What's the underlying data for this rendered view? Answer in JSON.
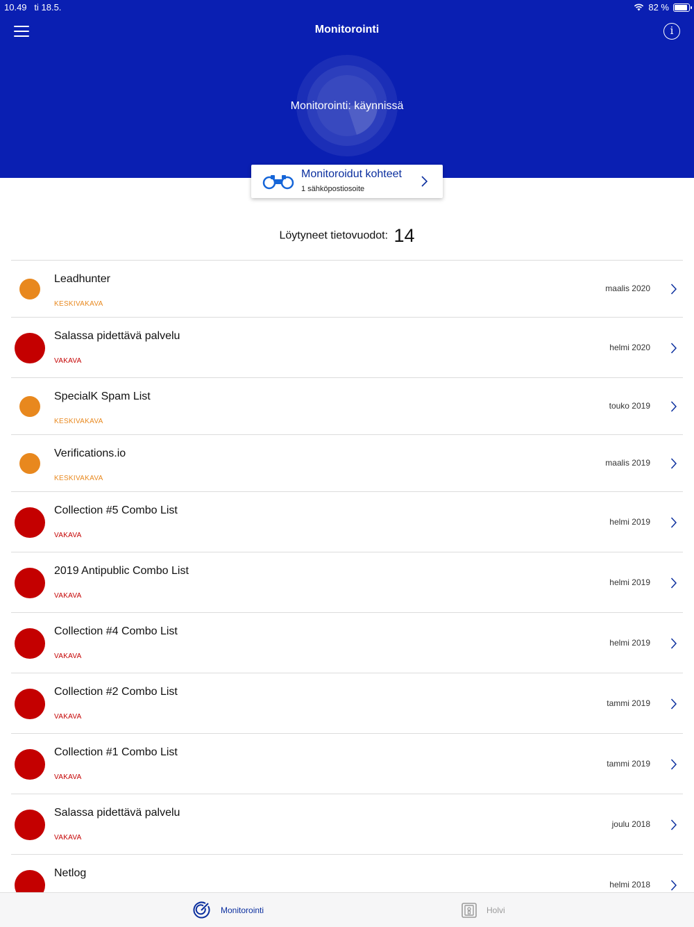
{
  "status_bar": {
    "time": "10.49",
    "date": "ti 18.5.",
    "battery": "82 %"
  },
  "nav": {
    "title": "Monitorointi"
  },
  "monitor": {
    "status_text": "Monitorointi: käynnissä"
  },
  "monitored_card": {
    "title": "Monitoroidut kohteet",
    "subtitle": "1 sähköpostiosoite"
  },
  "breaches": {
    "label": "Löytyneet tietovuodot:",
    "count": "14",
    "items": [
      {
        "name": "Leadhunter",
        "severity": "KESKIVAKAVA",
        "level": "medium",
        "date": "maalis 2020"
      },
      {
        "name": "Salassa pidettävä palvelu",
        "severity": "VAKAVA",
        "level": "high",
        "date": "helmi 2020"
      },
      {
        "name": "SpecialK Spam List",
        "severity": "KESKIVAKAVA",
        "level": "medium",
        "date": "touko 2019"
      },
      {
        "name": "Verifications.io",
        "severity": "KESKIVAKAVA",
        "level": "medium",
        "date": "maalis 2019"
      },
      {
        "name": "Collection #5 Combo List",
        "severity": "VAKAVA",
        "level": "high",
        "date": "helmi 2019"
      },
      {
        "name": "2019 Antipublic Combo List",
        "severity": "VAKAVA",
        "level": "high",
        "date": "helmi 2019"
      },
      {
        "name": "Collection #4 Combo List",
        "severity": "VAKAVA",
        "level": "high",
        "date": "helmi 2019"
      },
      {
        "name": "Collection #2 Combo List",
        "severity": "VAKAVA",
        "level": "high",
        "date": "tammi 2019"
      },
      {
        "name": "Collection #1 Combo List",
        "severity": "VAKAVA",
        "level": "high",
        "date": "tammi 2019"
      },
      {
        "name": "Salassa pidettävä palvelu",
        "severity": "VAKAVA",
        "level": "high",
        "date": "joulu 2018"
      },
      {
        "name": "Netlog",
        "severity": "",
        "level": "high",
        "date": "helmi 2018"
      }
    ]
  },
  "tabs": [
    {
      "label": "Monitorointi",
      "icon": "radar-icon",
      "active": true
    },
    {
      "label": "Holvi",
      "icon": "vault-icon",
      "active": false
    }
  ],
  "colors": {
    "header": "#0a1fb2",
    "accent": "#0a2e9e",
    "medium": "#e8881e",
    "high": "#c40000"
  }
}
